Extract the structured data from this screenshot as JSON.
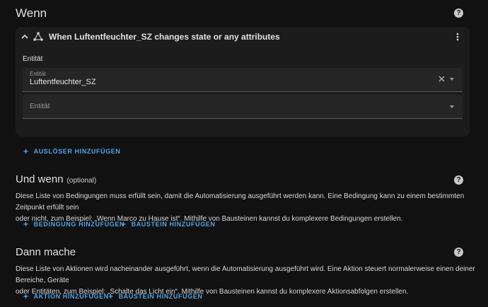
{
  "wenn": {
    "title": "Wenn",
    "trigger": {
      "title": "When Luftentfeuchter_SZ changes state or any attributes",
      "section_label": "Entität",
      "entity_field": {
        "label": "Entität",
        "value": "Luftentfeuchter_SZ"
      },
      "empty_field": {
        "placeholder": "Entität"
      }
    },
    "add_trigger": "AUSLÖSER HINZUFÜGEN"
  },
  "und_wenn": {
    "title": "Und wenn",
    "optional": "(optional)",
    "desc_line1": "Diese Liste von Bedingungen muss erfüllt sein, damit die Automatisierung ausgeführt werden kann. Eine Bedingung kann zu einem bestimmten Zeitpunkt erfüllt sein",
    "desc_line2": "oder nicht, zum Beispiel: „Wenn Marco zu Hause ist“. Mithilfe von Bausteinen kannst du komplexere Bedingungen erstellen.",
    "add_condition": "BEDINGUNG HINZUFÜGEN",
    "add_block": "BAUSTEIN HINZUFÜGEN"
  },
  "dann_mache": {
    "title": "Dann mache",
    "desc_line1": "Diese Liste von Aktionen wird nacheinander ausgeführt, wenn die Automatisierung ausgeführt wird. Eine Aktion steuert normalerweise einen deiner Bereiche, Geräte",
    "desc_line2": "oder Entitäten, zum Beispiel: „Schalte das Licht ein“. Mithilfe von Bausteinen kannst du komplexere Aktionsabfolgen erstellen.",
    "add_action": "AKTION HINZUFÜGEN",
    "add_block": "BAUSTEIN HINZUFÜGEN"
  },
  "icons": {
    "help": "help-circle-icon",
    "collapse": "chevron-up-icon",
    "trigger": "state-graph-icon",
    "menu": "dots-vertical-icon",
    "clear": "close-icon",
    "dropdown": "menu-down-icon",
    "add": "plus-icon"
  },
  "colors": {
    "accent": "#4fa3e7",
    "background": "#111111",
    "card": "#1c1c1c"
  }
}
